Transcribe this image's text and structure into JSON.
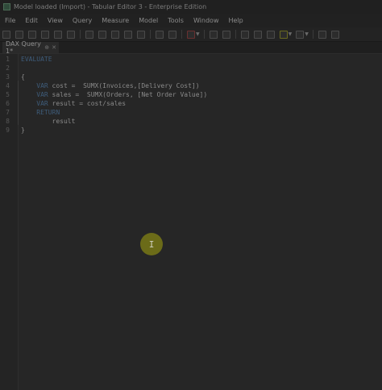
{
  "window": {
    "title": "Model loaded (Import) - Tabular Editor 3 - Enterprise Edition"
  },
  "menu": [
    "File",
    "Edit",
    "View",
    "Query",
    "Measure",
    "Model",
    "Tools",
    "Window",
    "Help"
  ],
  "tab": {
    "label": "DAX Query 1*",
    "pin": "⊕",
    "close": "✕"
  },
  "editor": {
    "line_numbers": [
      "1",
      "2",
      "3",
      "4",
      "5",
      "6",
      "7",
      "8",
      "9"
    ],
    "lines": [
      {
        "indent": "",
        "kw": "EVALUATE",
        "rest": ""
      },
      {
        "indent": "",
        "kw": "",
        "rest": ""
      },
      {
        "indent": "",
        "kw": "",
        "rest": "{"
      },
      {
        "indent": "    ",
        "kw": "VAR",
        "rest": " cost =  SUMX(Invoices,[Delivery Cost])"
      },
      {
        "indent": "    ",
        "kw": "VAR",
        "rest": " sales =  SUMX(Orders, [Net Order Value])"
      },
      {
        "indent": "    ",
        "kw": "VAR",
        "rest": " result = cost/sales"
      },
      {
        "indent": "    ",
        "kw": "RETURN",
        "rest": ""
      },
      {
        "indent": "        ",
        "kw": "",
        "rest": "result"
      },
      {
        "indent": "",
        "kw": "",
        "rest": "}"
      }
    ]
  },
  "cursor": {
    "glyph": "I"
  }
}
